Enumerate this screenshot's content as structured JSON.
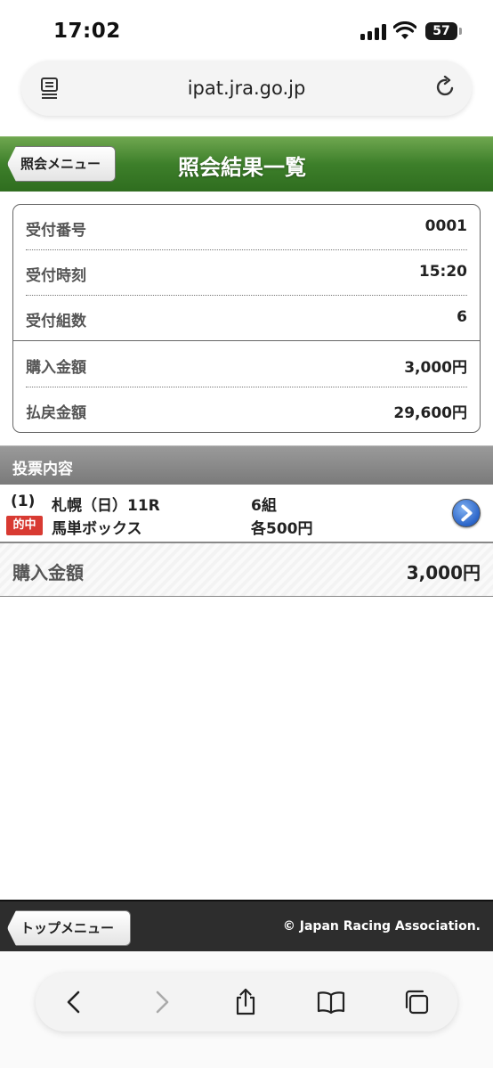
{
  "status": {
    "time": "17:02",
    "battery": "57"
  },
  "browser": {
    "url": "ipat.jra.go.jp",
    "reader_icon": "reader-icon",
    "reload_icon": "reload-icon"
  },
  "header": {
    "back_label": "照会メニュー",
    "title": "照会結果一覧"
  },
  "summary": {
    "rows": [
      {
        "label": "受付番号",
        "value": "0001"
      },
      {
        "label": "受付時刻",
        "value": "15:20"
      },
      {
        "label": "受付組数",
        "value": "6"
      },
      {
        "label": "購入金額",
        "value": "3,000円"
      },
      {
        "label": "払戻金額",
        "value": "29,600円"
      }
    ]
  },
  "section": {
    "title": "投票内容"
  },
  "bet": {
    "number": "(1)",
    "race": "札幌（日）11R",
    "sets": "6組",
    "badge": "的中",
    "type": "馬単ボックス",
    "each": "各500円"
  },
  "total": {
    "label": "購入金額",
    "value": "3,000円"
  },
  "footer": {
    "top_label": "トップメニュー",
    "copyright": "© Japan Racing Association."
  },
  "colors": {
    "header_green": "#3d7f2a",
    "hit_red": "#d83a32",
    "section_gray": "#8a8a8a",
    "footer_dark": "#2d2d2d"
  }
}
